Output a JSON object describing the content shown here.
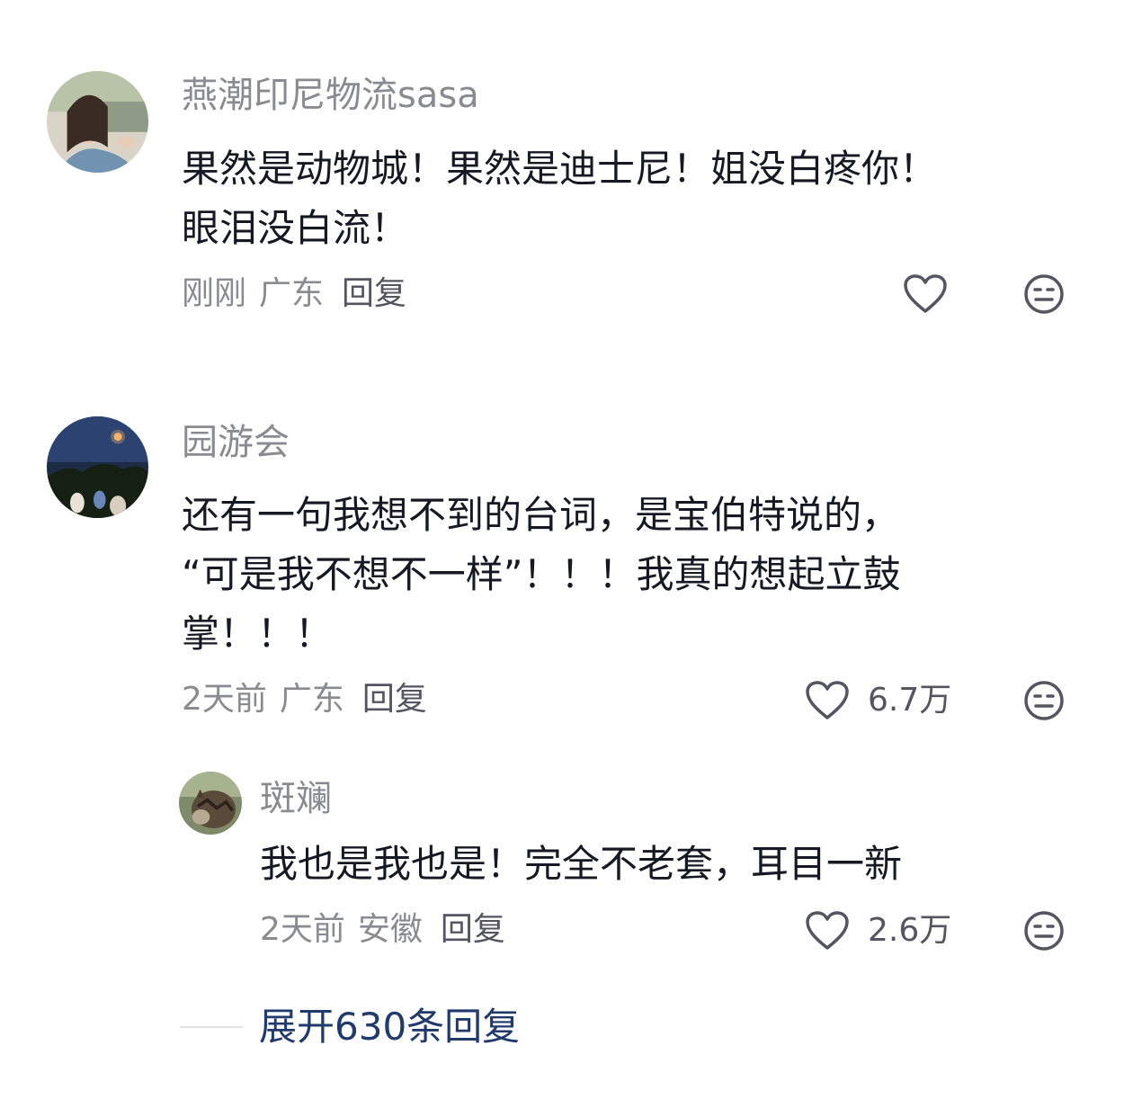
{
  "comments": [
    {
      "username": "燕潮印尼物流sasa",
      "text_lines": [
        "果然是动物城！果然是迪士尼！姐没白疼你！",
        "眼泪没白流！"
      ],
      "time": "刚刚",
      "location": "广东",
      "reply_label": "回复",
      "like_count": ""
    },
    {
      "username": "园游会",
      "text_lines": [
        "还有一句我想不到的台词，是宝伯特说的，",
        "“可是我不想不一样”！！！我真的想起立鼓",
        "掌！！！"
      ],
      "time": "2天前",
      "location": "广东",
      "reply_label": "回复",
      "like_count": "6.7万",
      "replies": [
        {
          "username": "斑斓",
          "text_lines": [
            "我也是我也是！完全不老套，耳目一新"
          ],
          "time": "2天前",
          "location": "安徽",
          "reply_label": "回复",
          "like_count": "2.6万"
        }
      ]
    }
  ],
  "expand_replies_label": "展开630条回复",
  "icons": {
    "like": "heart-outline-icon",
    "dislike": "meh-face-icon"
  },
  "colors": {
    "username": "#8a8b91",
    "text": "#161823",
    "expand": "#1f3a6b"
  }
}
